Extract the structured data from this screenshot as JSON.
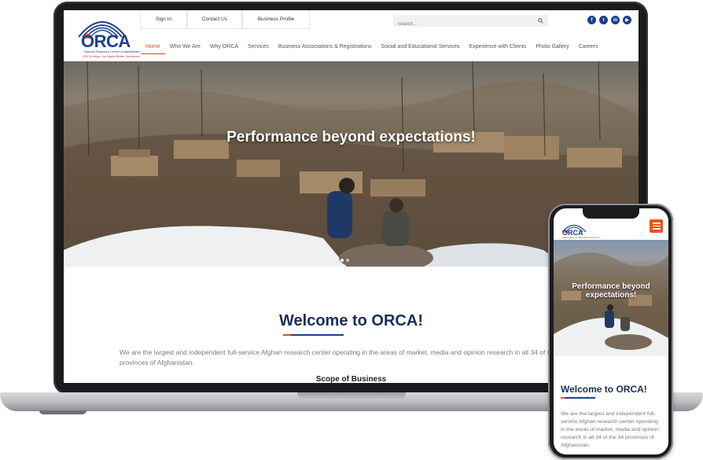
{
  "brand": {
    "name": "ORCA",
    "subtitle": "Opinion Research Center of Afghanistan",
    "tagline": "ORCA Helps You Make Better Decisions!",
    "primary_color": "#1c3f8f",
    "accent_color": "#e04e24"
  },
  "topbar": {
    "links": [
      "Sign In",
      "Contact Us",
      "Business Profile"
    ],
    "search_placeholder": "Search...",
    "search_icon": "search-icon",
    "socials": [
      {
        "icon": "facebook-icon",
        "glyph": "f"
      },
      {
        "icon": "twitter-icon",
        "glyph": "t"
      },
      {
        "icon": "linkedin-icon",
        "glyph": "in"
      },
      {
        "icon": "youtube-icon",
        "glyph": "▶"
      }
    ]
  },
  "nav": {
    "items": [
      "Home",
      "Who We Are",
      "Why ORCA",
      "Services",
      "Business Associations & Registrations",
      "Social and Educational Services",
      "Experience with Clients",
      "Photo Gallery",
      "Careers"
    ],
    "active": "Home"
  },
  "hero": {
    "title": "Performance beyond expectations!",
    "mobile_title": "Performance beyond expectations!"
  },
  "welcome": {
    "title": "Welcome to ORCA!",
    "text": "We are the largest and independent full-service Afghan research center operating in the areas of market, media and opinion research in all 34 of the 34 provinces of Afghanistan.",
    "scope_title": "Scope of Business"
  },
  "mobile": {
    "menu_icon": "hamburger-menu-icon",
    "welcome_title": "Welcome to ORCA!",
    "text": "We are the largest and independent full-service Afghan research center operating in the areas of market, media and opinion research in all 34 of the 34 provinces of Afghanistan."
  }
}
